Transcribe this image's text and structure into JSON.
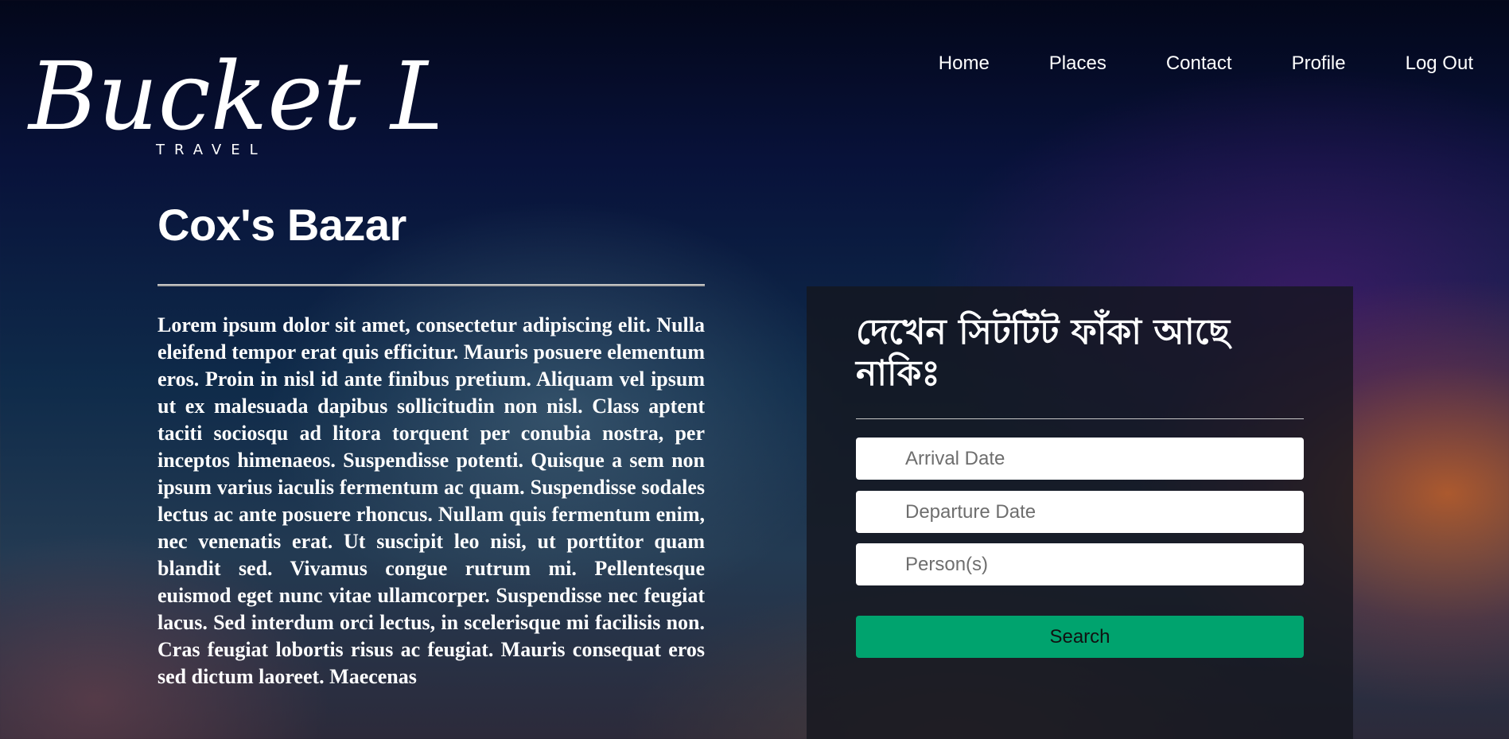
{
  "brand": {
    "logo_text": "Bucket List",
    "logo_subtext": "TRAVEL"
  },
  "nav": {
    "items": [
      {
        "label": "Home"
      },
      {
        "label": "Places"
      },
      {
        "label": "Contact"
      },
      {
        "label": "Profile"
      },
      {
        "label": "Log Out"
      }
    ]
  },
  "place": {
    "title": "Cox's Bazar",
    "description": "Lorem ipsum dolor sit amet, consectetur adipiscing elit. Nulla eleifend tempor erat quis efficitur. Mauris posuere elementum eros. Proin in nisl id ante finibus pretium. Aliquam vel ipsum ut ex malesuada dapibus sollicitudin non nisl. Class aptent taciti sociosqu ad litora torquent per conubia nostra, per inceptos himenaeos. Suspendisse potenti. Quisque a sem non ipsum varius iaculis fermentum ac quam. Suspendisse sodales lectus ac ante posuere rhoncus. Nullam quis fermentum enim, nec venenatis erat. Ut suscipit leo nisi, ut porttitor quam blandit sed. Vivamus congue rutrum mi. Pellentesque euismod eget nunc vitae ullamcorper. Suspendisse nec feugiat lacus. Sed interdum orci lectus, in scelerisque mi facilisis non. Cras feugiat lobortis risus ac feugiat. Mauris consequat eros sed dictum laoreet. Maecenas"
  },
  "booking": {
    "heading": "দেখেন সিটটিট ফাঁকা আছে নাকিঃ",
    "arrival_placeholder": "Arrival Date",
    "departure_placeholder": "Departure Date",
    "persons_placeholder": "Person(s)",
    "search_label": "Search",
    "button_color": "#00a36e"
  }
}
